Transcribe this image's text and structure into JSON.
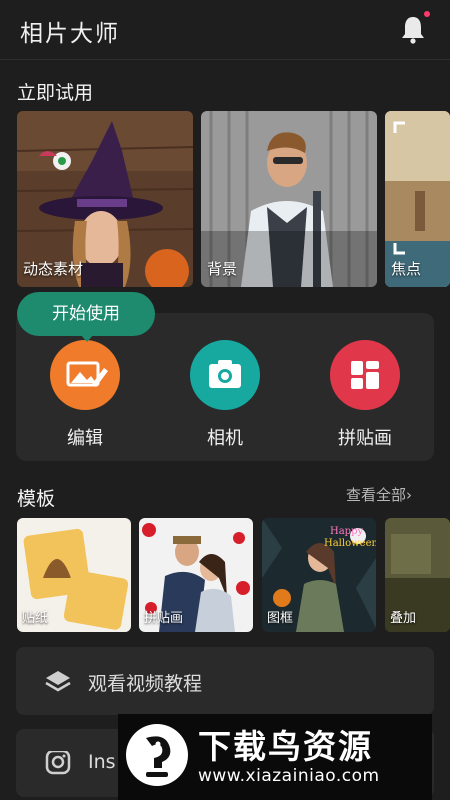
{
  "header": {
    "title": "相片大师",
    "bell_icon": "bell-icon",
    "has_notification": true,
    "notification_color": "#ff3b6b"
  },
  "try_now": {
    "title": "立即试用",
    "cards": [
      {
        "label": "动态素材"
      },
      {
        "label": "背景"
      },
      {
        "label": "焦点"
      }
    ]
  },
  "tools": {
    "tooltip": "开始使用",
    "items": [
      {
        "label": "编辑",
        "icon": "photo-edit-icon",
        "color": "#f07b2a"
      },
      {
        "label": "相机",
        "icon": "camera-icon",
        "color": "#17a8a0"
      },
      {
        "label": "拼贴画",
        "icon": "collage-icon",
        "color": "#e0384a"
      }
    ]
  },
  "templates": {
    "title": "模板",
    "see_all": "查看全部",
    "cards": [
      {
        "label": "贴纸"
      },
      {
        "label": "拼贴画"
      },
      {
        "label": "图框"
      },
      {
        "label": "叠加"
      }
    ]
  },
  "rows": [
    {
      "label": "观看视频教程",
      "icon": "layers-icon"
    },
    {
      "label": "Ins",
      "icon": "instagram-icon"
    }
  ],
  "watermark": {
    "title": "下载鸟资源",
    "url": "www.xiazainiao.com"
  }
}
